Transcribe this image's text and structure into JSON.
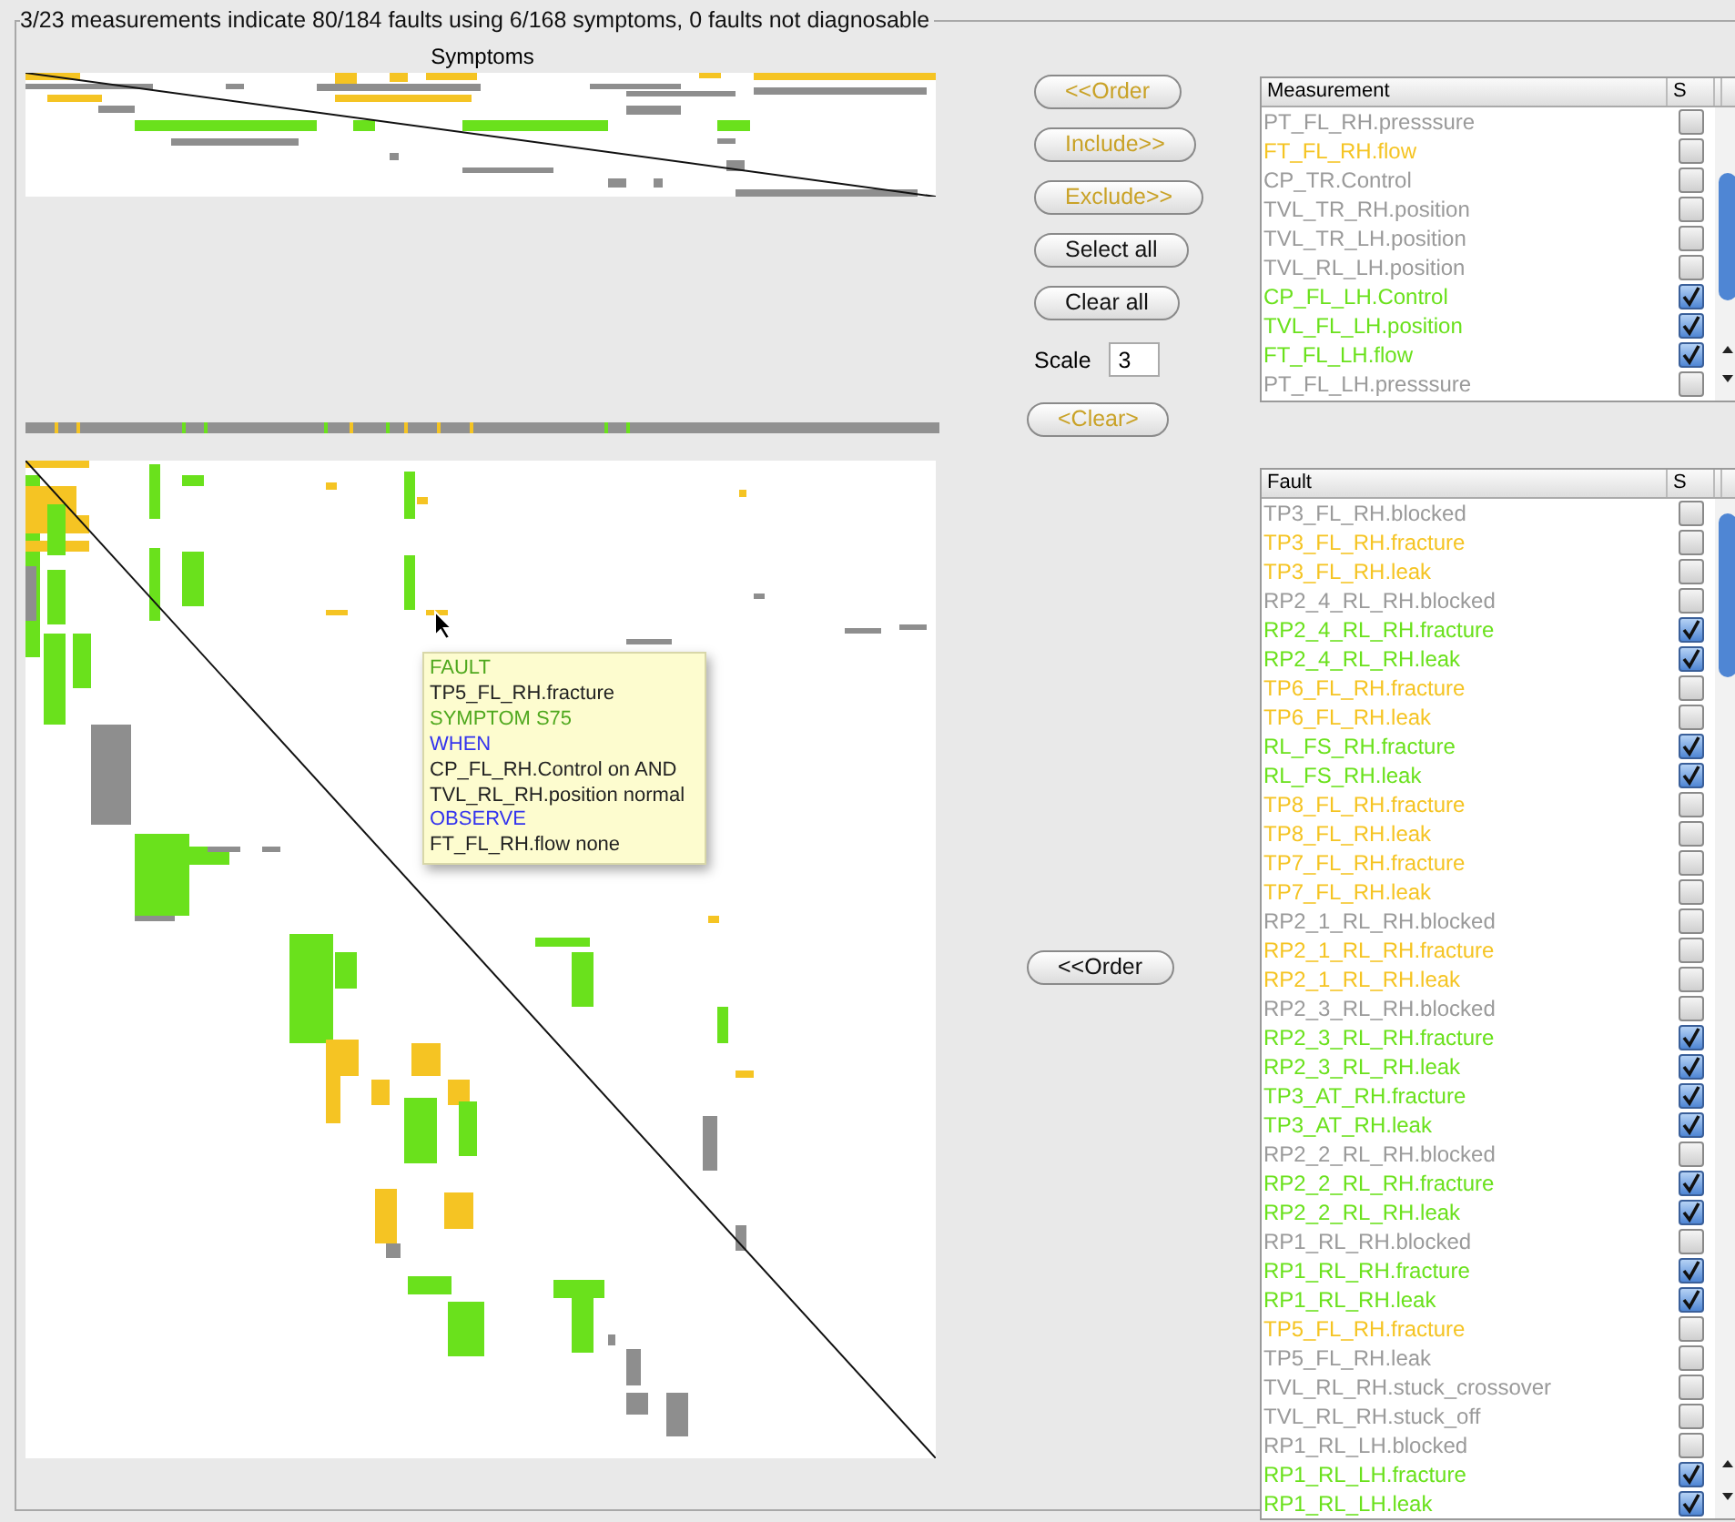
{
  "group_title": "3/23 measurements indicate 80/184 faults using 6/168 symptoms, 0 faults not diagnosable",
  "symptoms_label": "Symptoms",
  "buttons_top": [
    {
      "label": "<<Order",
      "color": "#c9a227"
    },
    {
      "label": "Include>>",
      "color": "#c9a227"
    },
    {
      "label": "Exclude>>",
      "color": "#c9a227"
    },
    {
      "label": "Select all",
      "color": "#111111"
    },
    {
      "label": "Clear all",
      "color": "#111111"
    }
  ],
  "scale": {
    "label": "Scale",
    "value": "3"
  },
  "clear_button": {
    "label": "<Clear>",
    "color": "#c9a227"
  },
  "lower_order_button": {
    "label": "<<Order",
    "color": "#111111"
  },
  "measurements": {
    "columns": [
      "Measurement",
      "S"
    ],
    "rows": [
      {
        "name": "PT_FL_RH.presssure",
        "color": "#9a9a9a",
        "checked": false
      },
      {
        "name": "FT_FL_RH.flow",
        "color": "#f5c423",
        "checked": false
      },
      {
        "name": "CP_TR.Control",
        "color": "#9a9a9a",
        "checked": false
      },
      {
        "name": "TVL_TR_RH.position",
        "color": "#9a9a9a",
        "checked": false
      },
      {
        "name": "TVL_TR_LH.position",
        "color": "#9a9a9a",
        "checked": false
      },
      {
        "name": "TVL_RL_LH.position",
        "color": "#9a9a9a",
        "checked": false
      },
      {
        "name": "CP_FL_LH.Control",
        "color": "#6ae11c",
        "checked": true
      },
      {
        "name": "TVL_FL_LH.position",
        "color": "#6ae11c",
        "checked": true
      },
      {
        "name": "FT_FL_LH.flow",
        "color": "#6ae11c",
        "checked": true
      },
      {
        "name": "PT_FL_LH.presssure",
        "color": "#9a9a9a",
        "checked": false
      }
    ]
  },
  "faults": {
    "columns": [
      "Fault",
      "S"
    ],
    "rows": [
      {
        "name": "TP3_FL_RH.blocked",
        "color": "#9a9a9a",
        "checked": false
      },
      {
        "name": "TP3_FL_RH.fracture",
        "color": "#f5c423",
        "checked": false
      },
      {
        "name": "TP3_FL_RH.leak",
        "color": "#f5c423",
        "checked": false
      },
      {
        "name": "RP2_4_RL_RH.blocked",
        "color": "#9a9a9a",
        "checked": false
      },
      {
        "name": "RP2_4_RL_RH.fracture",
        "color": "#6ae11c",
        "checked": true
      },
      {
        "name": "RP2_4_RL_RH.leak",
        "color": "#6ae11c",
        "checked": true
      },
      {
        "name": "TP6_FL_RH.fracture",
        "color": "#f5c423",
        "checked": false
      },
      {
        "name": "TP6_FL_RH.leak",
        "color": "#f5c423",
        "checked": false
      },
      {
        "name": "RL_FS_RH.fracture",
        "color": "#6ae11c",
        "checked": true
      },
      {
        "name": "RL_FS_RH.leak",
        "color": "#6ae11c",
        "checked": true
      },
      {
        "name": "TP8_FL_RH.fracture",
        "color": "#f5c423",
        "checked": false
      },
      {
        "name": "TP8_FL_RH.leak",
        "color": "#f5c423",
        "checked": false
      },
      {
        "name": "TP7_FL_RH.fracture",
        "color": "#f5c423",
        "checked": false
      },
      {
        "name": "TP7_FL_RH.leak",
        "color": "#f5c423",
        "checked": false
      },
      {
        "name": "RP2_1_RL_RH.blocked",
        "color": "#9a9a9a",
        "checked": false
      },
      {
        "name": "RP2_1_RL_RH.fracture",
        "color": "#f5c423",
        "checked": false
      },
      {
        "name": "RP2_1_RL_RH.leak",
        "color": "#f5c423",
        "checked": false
      },
      {
        "name": "RP2_3_RL_RH.blocked",
        "color": "#9a9a9a",
        "checked": false
      },
      {
        "name": "RP2_3_RL_RH.fracture",
        "color": "#6ae11c",
        "checked": true
      },
      {
        "name": "RP2_3_RL_RH.leak",
        "color": "#6ae11c",
        "checked": true
      },
      {
        "name": "TP3_AT_RH.fracture",
        "color": "#6ae11c",
        "checked": true
      },
      {
        "name": "TP3_AT_RH.leak",
        "color": "#6ae11c",
        "checked": true
      },
      {
        "name": "RP2_2_RL_RH.blocked",
        "color": "#9a9a9a",
        "checked": false
      },
      {
        "name": "RP2_2_RL_RH.fracture",
        "color": "#6ae11c",
        "checked": true
      },
      {
        "name": "RP2_2_RL_RH.leak",
        "color": "#6ae11c",
        "checked": true
      },
      {
        "name": "RP1_RL_RH.blocked",
        "color": "#9a9a9a",
        "checked": false
      },
      {
        "name": "RP1_RL_RH.fracture",
        "color": "#6ae11c",
        "checked": true
      },
      {
        "name": "RP1_RL_RH.leak",
        "color": "#6ae11c",
        "checked": true
      },
      {
        "name": "TP5_FL_RH.fracture",
        "color": "#f5c423",
        "checked": false
      },
      {
        "name": "TP5_FL_RH.leak",
        "color": "#9a9a9a",
        "checked": false
      },
      {
        "name": "TVL_RL_RH.stuck_crossover",
        "color": "#9a9a9a",
        "checked": false
      },
      {
        "name": "TVL_RL_RH.stuck_off",
        "color": "#9a9a9a",
        "checked": false
      },
      {
        "name": "RP1_RL_LH.blocked",
        "color": "#9a9a9a",
        "checked": false
      },
      {
        "name": "RP1_RL_LH.fracture",
        "color": "#6ae11c",
        "checked": true
      },
      {
        "name": "RP1_RL_LH.leak",
        "color": "#6ae11c",
        "checked": true
      }
    ]
  },
  "tooltip": {
    "lines": [
      {
        "text": "FAULT",
        "color": "#4fa81e"
      },
      {
        "text": "TP5_FL_RH.fracture",
        "color": "#222222"
      },
      {
        "text": "SYMPTOM S75",
        "color": "#4fa81e"
      },
      {
        "text": "WHEN",
        "color": "#3333ee"
      },
      {
        "text": "CP_FL_RH.Control on AND",
        "color": "#222222"
      },
      {
        "text": "TVL_RL_RH.position normal",
        "color": "#222222"
      },
      {
        "text": "OBSERVE",
        "color": "#3333ee"
      },
      {
        "text": "FT_FL_RH.flow none",
        "color": "#222222"
      }
    ]
  }
}
